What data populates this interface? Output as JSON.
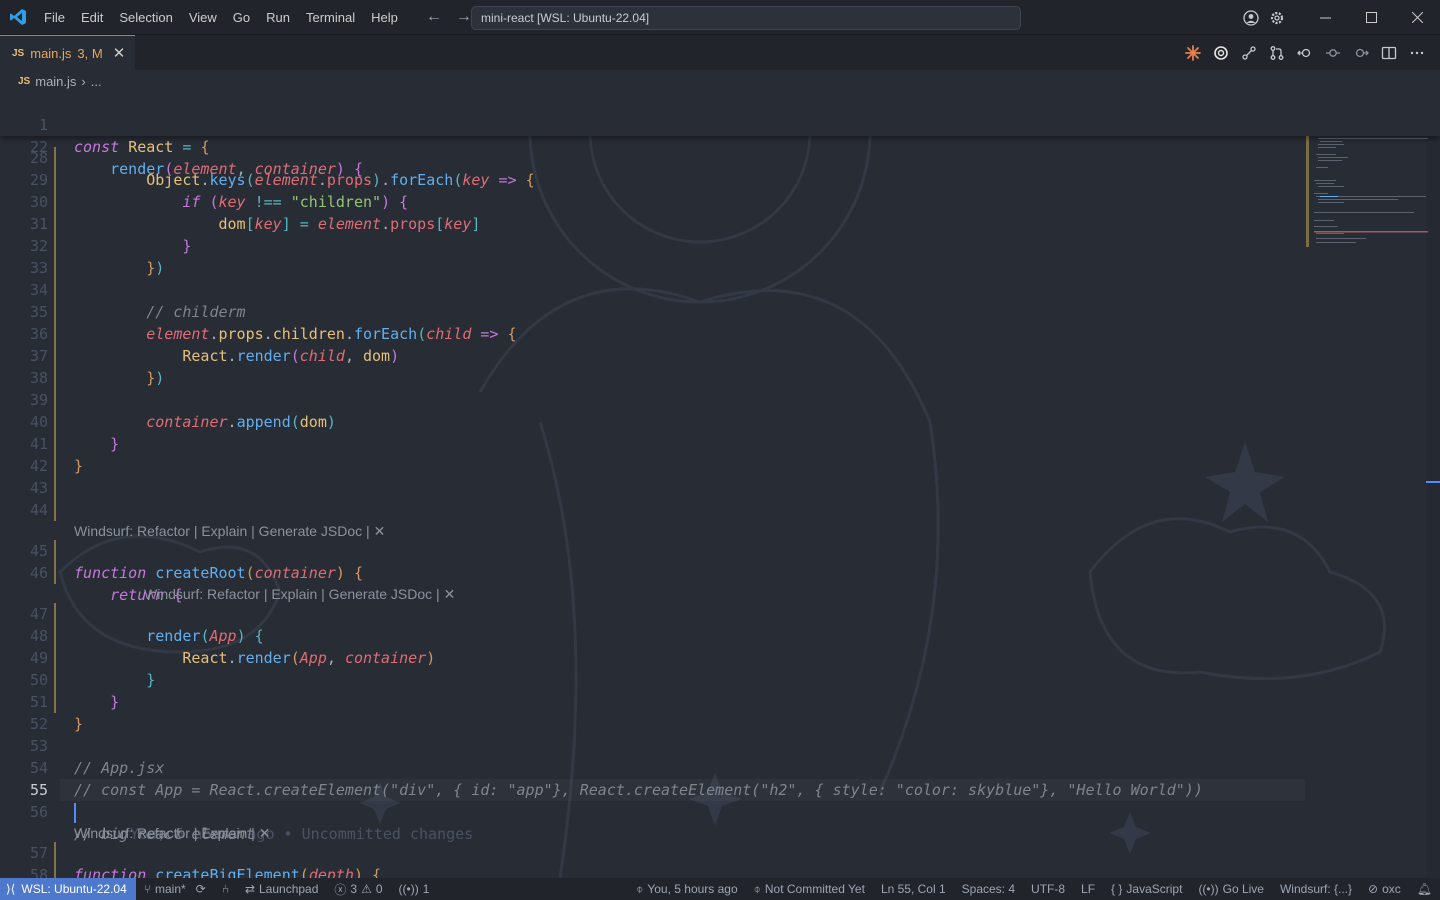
{
  "titlebar": {
    "menu": [
      "File",
      "Edit",
      "Selection",
      "View",
      "Go",
      "Run",
      "Terminal",
      "Help"
    ],
    "command_center": "mini-react [WSL: Ubuntu-22.04]"
  },
  "tab": {
    "lang": "JS",
    "name": "main.js",
    "badge": "3, M",
    "close": "✕"
  },
  "breadcrumb": {
    "lang": "JS",
    "file": "main.js",
    "sep": "›",
    "rest": "..."
  },
  "editor": {
    "line_numbers": [
      "1",
      "22",
      "28",
      "29",
      "30",
      "31",
      "32",
      "33",
      "34",
      "35",
      "36",
      "37",
      "38",
      "39",
      "40",
      "41",
      "42",
      "43",
      "44",
      "45",
      "46",
      "47",
      "48",
      "49",
      "50",
      "51",
      "52",
      "53",
      "54",
      "55",
      "56",
      "57",
      "58"
    ],
    "lens_1": "Windsurf: Refactor | Explain | Generate JSDoc |",
    "lens_2": "Windsurf: Refactor | Explain | Generate JSDoc |",
    "lens_3": "Windsurf: Refactor | Explain |",
    "blame": "You, 5 hours ago • Uncommitted changes",
    "active_line": "55",
    "colors": {
      "background": "#282c34",
      "keyword": "#c678dd",
      "function": "#61afef",
      "string": "#98c379",
      "param": "#e06c75",
      "class": "#e5c07b",
      "comment": "#7f848e"
    }
  },
  "statusbar": {
    "remote": "WSL: Ubuntu-22.04",
    "branch": "main*",
    "launchpad": "Launchpad",
    "errors": "3",
    "warnings": "0",
    "ports": "1",
    "blame": "You, 5 hours ago",
    "commit": "Not Committed Yet",
    "position": "Ln 55, Col 1",
    "spaces": "Spaces: 4",
    "encoding": "UTF-8",
    "eol": "LF",
    "language": "JavaScript",
    "golive": "Go Live",
    "windsurf": "Windsurf: {...}",
    "oxc": "oxc"
  }
}
